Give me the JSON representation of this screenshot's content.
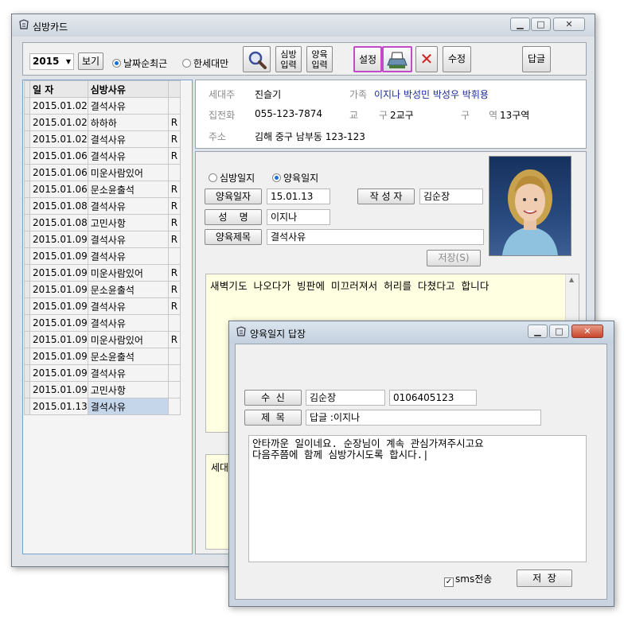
{
  "main_window": {
    "title": "심방카드"
  },
  "toolbar": {
    "year_value": "2015",
    "view_button": "보기",
    "radio_date": "날짜순최근",
    "radio_household": "한세대만",
    "visit_entry_l1": "심방",
    "visit_entry_l2": "입력",
    "care_entry_l1": "양육",
    "care_entry_l2": "입력",
    "settings_button": "설정",
    "edit_button": "수정",
    "reply_button": "답글"
  },
  "list": {
    "header_date": "일 자",
    "header_reason": "심방사유",
    "rows": [
      {
        "date": "2015.01.02",
        "reason": "결석사유",
        "flag": ""
      },
      {
        "date": "2015.01.02",
        "reason": "하하하",
        "flag": "R"
      },
      {
        "date": "2015.01.02",
        "reason": "결석사유",
        "flag": "R"
      },
      {
        "date": "2015.01.06",
        "reason": "결석사유",
        "flag": "R"
      },
      {
        "date": "2015.01.06",
        "reason": "미운사람있어",
        "flag": ""
      },
      {
        "date": "2015.01.06",
        "reason": "문소윤출석",
        "flag": "R"
      },
      {
        "date": "2015.01.08",
        "reason": "결석사유",
        "flag": "R"
      },
      {
        "date": "2015.01.08",
        "reason": "고민사항",
        "flag": "R"
      },
      {
        "date": "2015.01.09",
        "reason": "결석사유",
        "flag": "R"
      },
      {
        "date": "2015.01.09",
        "reason": "결석사유",
        "flag": ""
      },
      {
        "date": "2015.01.09",
        "reason": "미운사람있어",
        "flag": "R"
      },
      {
        "date": "2015.01.09",
        "reason": "문소윤출석",
        "flag": "R"
      },
      {
        "date": "2015.01.09",
        "reason": "결석사유",
        "flag": "R"
      },
      {
        "date": "2015.01.09",
        "reason": "결석사유",
        "flag": ""
      },
      {
        "date": "2015.01.09",
        "reason": "미운사람있어",
        "flag": "R"
      },
      {
        "date": "2015.01.09",
        "reason": "문소윤출석",
        "flag": ""
      },
      {
        "date": "2015.01.09",
        "reason": "결석사유",
        "flag": ""
      },
      {
        "date": "2015.01.09",
        "reason": "고민사항",
        "flag": ""
      },
      {
        "date": "2015.01.13",
        "reason": "결석사유",
        "flag": ""
      }
    ]
  },
  "info": {
    "head_label": "세대주",
    "head_value": "진슬기",
    "family_label": "가족",
    "family_value": "이지나  박성민  박성우  박휘용",
    "phone_label": "집전화",
    "phone_value": "055-123-7874",
    "district_label1": "교",
    "district_label2": "구",
    "district_value": "2교구",
    "area_label1": "구",
    "area_label2": "역",
    "area_value": "13구역",
    "address_label": "주소",
    "address_value": "김해 중구 남부동 123-123"
  },
  "form": {
    "radio_visit": "심방일지",
    "radio_care": "양육일지",
    "care_date_label": "양육일자",
    "care_date_value": "15.01.13",
    "author_label": "작 성 자",
    "author_value": "김순장",
    "name_label": "성    명",
    "name_value": "이지나",
    "care_title_label": "양육제목",
    "care_title_value": "결석사유",
    "save_button": "저장(S)",
    "note_text": "새벽기도 나오다가 빙판에 미끄러져서 허리를 다쳤다고 합니다",
    "lower_label_partial": "세대"
  },
  "reply_window": {
    "title": "양육일지 답장",
    "recipient_label": "수  신",
    "recipient_name": "김순장",
    "recipient_phone": "0106405123",
    "subject_label": "제  목",
    "subject_value": "답글 :이지나",
    "message_line1": "안타까운 일이네요. 순장님이 계속 관심가져주시고요",
    "message_line2": "다음주쯤에 함께 심방가시도록 합시다.|",
    "sms_label": "sms전송",
    "save_button": "저  장"
  },
  "colors": {
    "note_bg": "#ffffe1",
    "selected_row": "#c5d5ea",
    "blue_text": "#1b2a9a"
  }
}
